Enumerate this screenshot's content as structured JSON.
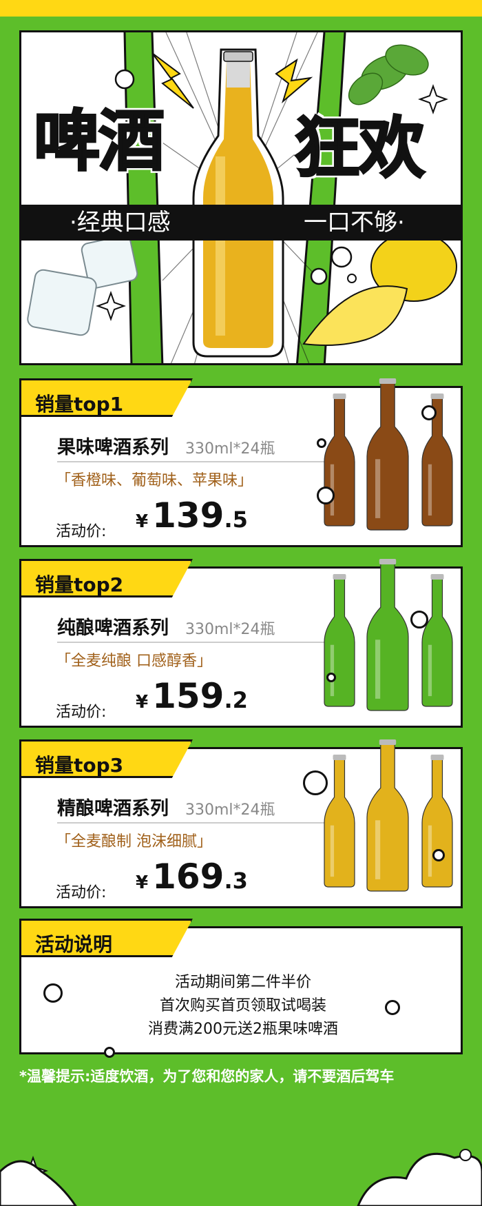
{
  "hero": {
    "title_left": "啤酒",
    "title_right": "狂欢",
    "tagline_left": "·经典口感",
    "tagline_right": "一口不够·"
  },
  "products": [
    {
      "rank_label": "销量top1",
      "name": "果味啤酒系列",
      "spec": "330ml*24瓶",
      "flavor": "「香橙味、葡萄味、苹果味」",
      "price_label": "活动价:",
      "currency": "¥",
      "price_int": "139",
      "price_dec": ".5",
      "bottle_color": "#8a4a16"
    },
    {
      "rank_label": "销量top2",
      "name": "纯酿啤酒系列",
      "spec": "330ml*24瓶",
      "flavor": "「全麦纯酿 口感醇香」",
      "price_label": "活动价:",
      "currency": "¥",
      "price_int": "159",
      "price_dec": ".2",
      "bottle_color": "#56b324"
    },
    {
      "rank_label": "销量top3",
      "name": "精酿啤酒系列",
      "spec": "330ml*24瓶",
      "flavor": "「全麦酿制 泡沫细腻」",
      "price_label": "活动价:",
      "currency": "¥",
      "price_int": "169",
      "price_dec": ".3",
      "bottle_color": "#e2b21c"
    }
  ],
  "notes": {
    "title": "活动说明",
    "lines": [
      "活动期间第二件半价",
      "首次购买首页领取试喝装",
      "消费满200元送2瓶果味啤酒"
    ]
  },
  "warning": "*温馨提示:适度饮酒，为了您和您的家人，请不要酒后驾车",
  "colors": {
    "background": "#5dbe2a",
    "accent": "#ffd814",
    "ink": "#111111"
  }
}
